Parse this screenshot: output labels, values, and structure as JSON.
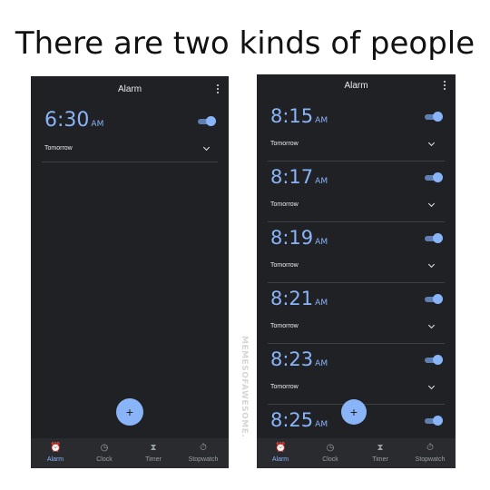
{
  "headline": "There are two kinds of people",
  "watermark": "MEMESOFAWESOME.",
  "left_phone": {
    "title": "Alarm",
    "alarm": {
      "time": "6:30",
      "ampm": "AM",
      "label": "Tomorrow",
      "enabled": true
    },
    "fab_label": "+",
    "nav": [
      "Alarm",
      "Clock",
      "Timer",
      "Stopwatch"
    ]
  },
  "right_phone": {
    "title": "Alarm",
    "alarms": [
      {
        "time": "8:15",
        "ampm": "AM",
        "label": "Tomorrow",
        "enabled": true
      },
      {
        "time": "8:17",
        "ampm": "AM",
        "label": "Tomorrow",
        "enabled": true
      },
      {
        "time": "8:19",
        "ampm": "AM",
        "label": "Tomorrow",
        "enabled": true
      },
      {
        "time": "8:21",
        "ampm": "AM",
        "label": "Tomorrow",
        "enabled": true
      },
      {
        "time": "8:23",
        "ampm": "AM",
        "label": "Tomorrow",
        "enabled": true
      },
      {
        "time": "8:25",
        "ampm": "AM",
        "label": "",
        "enabled": true
      }
    ],
    "fab_label": "+",
    "nav": [
      "Alarm",
      "Clock",
      "Timer",
      "Stopwatch"
    ]
  },
  "colors": {
    "background": "#202124",
    "accent": "#8ab4f8",
    "text": "#e8eaed"
  },
  "icons": {
    "alarm": "alarm-clock-icon",
    "clock": "clock-icon",
    "timer": "hourglass-icon",
    "stopwatch": "stopwatch-icon"
  }
}
